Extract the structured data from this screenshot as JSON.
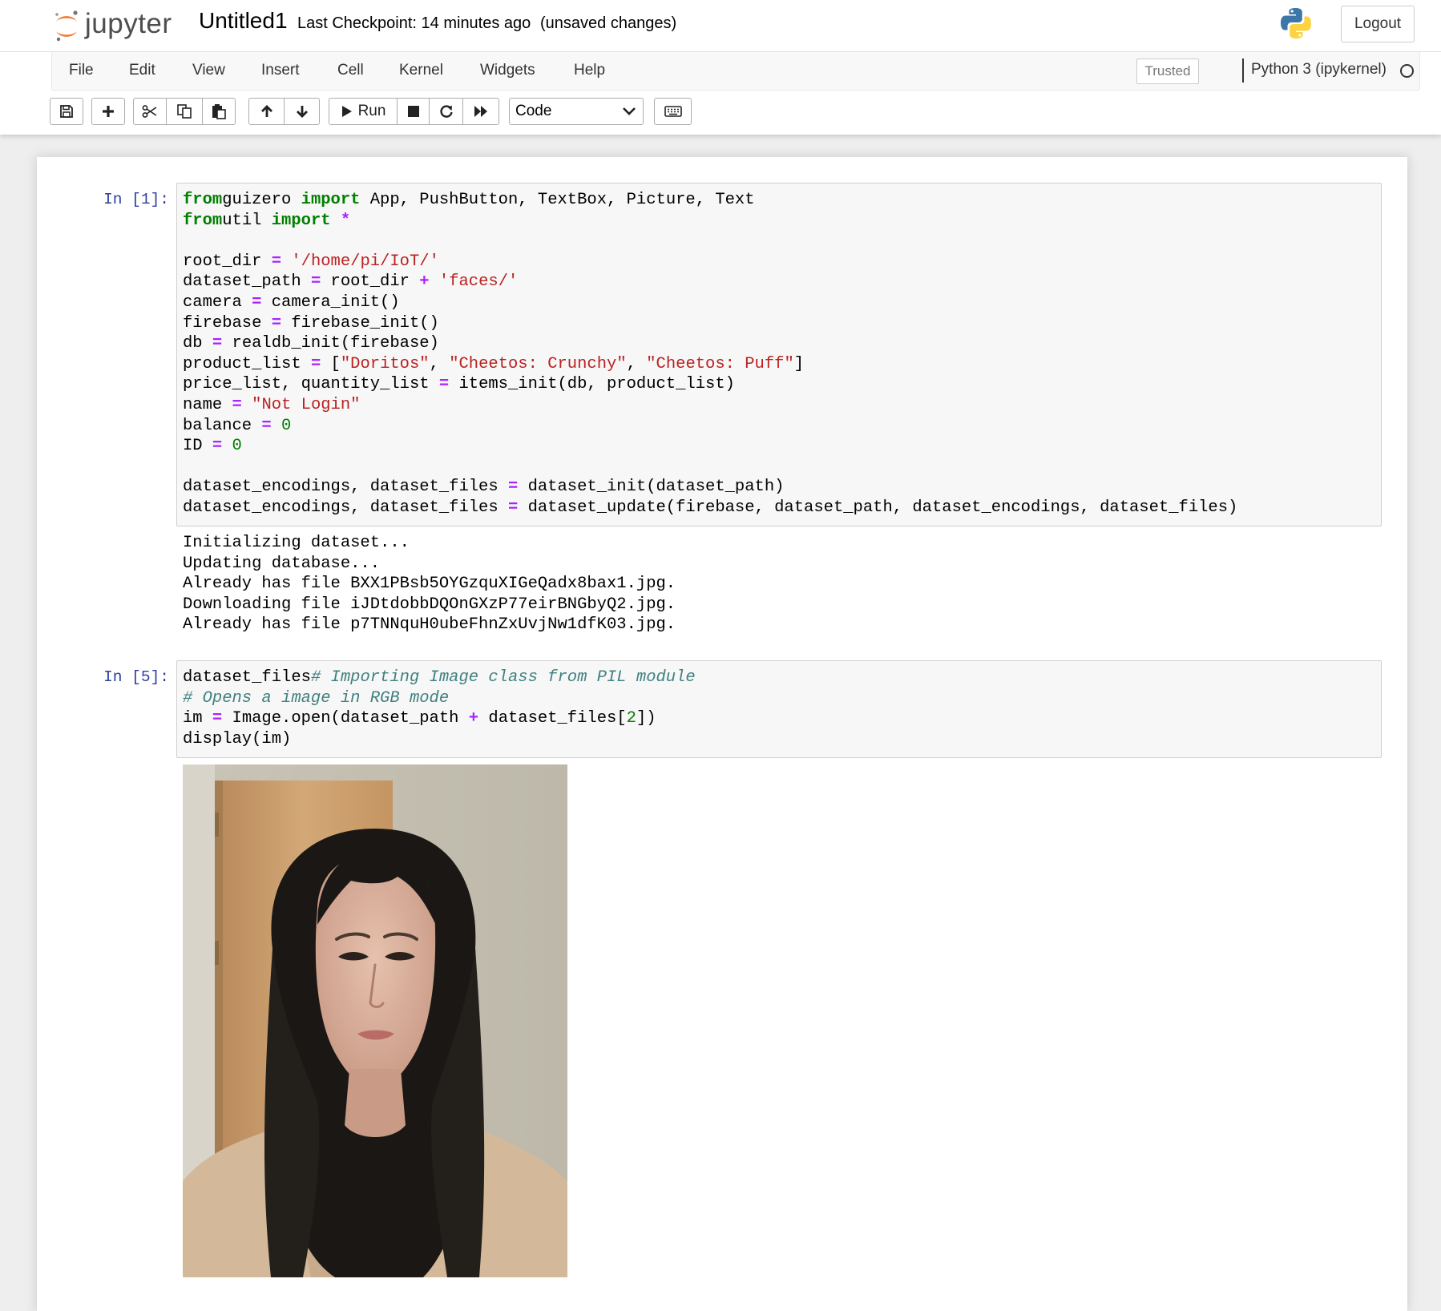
{
  "header": {
    "logo_text": "jupyter",
    "notebook_name": "Untitled1",
    "checkpoint": "Last Checkpoint: 14 minutes ago",
    "save_status": "(unsaved changes)",
    "logout_label": "Logout"
  },
  "menu": {
    "items": [
      "File",
      "Edit",
      "View",
      "Insert",
      "Cell",
      "Kernel",
      "Widgets",
      "Help"
    ],
    "trusted_label": "Trusted",
    "kernel_name": "Python 3 (ipykernel)"
  },
  "toolbar": {
    "run_label": "Run",
    "cell_type": "Code",
    "icons": [
      "save-icon",
      "plus-icon",
      "cut-icon",
      "copy-icon",
      "paste-icon",
      "arrow-up-icon",
      "arrow-down-icon",
      "play-icon",
      "stop-icon",
      "restart-icon",
      "fast-forward-icon",
      "keyboard-icon"
    ]
  },
  "cells": [
    {
      "prompt": "In [1]:",
      "code_lines": [
        [
          [
            "kw",
            "from"
          ],
          [
            "",
            "guizero "
          ],
          [
            "kw",
            "import"
          ],
          [
            "",
            " App, PushButton, TextBox, Picture, Text"
          ]
        ],
        [
          [
            "kw",
            "from"
          ],
          [
            "",
            "util "
          ],
          [
            "kw",
            "import"
          ],
          [
            "",
            " "
          ],
          [
            "op",
            "*"
          ]
        ],
        [],
        [
          [
            "",
            "root_dir "
          ],
          [
            "op",
            "="
          ],
          [
            "",
            " "
          ],
          [
            "st",
            "'/home/pi/IoT/'"
          ]
        ],
        [
          [
            "",
            "dataset_path "
          ],
          [
            "op",
            "="
          ],
          [
            "",
            " root_dir "
          ],
          [
            "op",
            "+"
          ],
          [
            "",
            " "
          ],
          [
            "st",
            "'faces/'"
          ]
        ],
        [
          [
            "",
            "camera "
          ],
          [
            "op",
            "="
          ],
          [
            "",
            " camera_init()"
          ]
        ],
        [
          [
            "",
            "firebase "
          ],
          [
            "op",
            "="
          ],
          [
            "",
            " firebase_init()"
          ]
        ],
        [
          [
            "",
            "db "
          ],
          [
            "op",
            "="
          ],
          [
            "",
            " realdb_init(firebase)"
          ]
        ],
        [
          [
            "",
            "product_list "
          ],
          [
            "op",
            "="
          ],
          [
            "",
            " ["
          ],
          [
            "st",
            "\"Doritos\""
          ],
          [
            "",
            ", "
          ],
          [
            "st",
            "\"Cheetos: Crunchy\""
          ],
          [
            "",
            ", "
          ],
          [
            "st",
            "\"Cheetos: Puff\""
          ],
          [
            "",
            "]"
          ]
        ],
        [
          [
            "",
            "price_list, quantity_list "
          ],
          [
            "op",
            "="
          ],
          [
            "",
            " items_init(db, product_list)"
          ]
        ],
        [
          [
            "",
            "name "
          ],
          [
            "op",
            "="
          ],
          [
            "",
            " "
          ],
          [
            "st",
            "\"Not Login\""
          ]
        ],
        [
          [
            "",
            "balance "
          ],
          [
            "op",
            "="
          ],
          [
            "",
            " "
          ],
          [
            "nm",
            "0"
          ]
        ],
        [
          [
            "",
            "ID "
          ],
          [
            "op",
            "="
          ],
          [
            "",
            " "
          ],
          [
            "nm",
            "0"
          ]
        ],
        [],
        [
          [
            "",
            "dataset_encodings, dataset_files "
          ],
          [
            "op",
            "="
          ],
          [
            "",
            " dataset_init(dataset_path)"
          ]
        ],
        [
          [
            "",
            "dataset_encodings, dataset_files "
          ],
          [
            "op",
            "="
          ],
          [
            "",
            " dataset_update(firebase, dataset_path, dataset_encodings, dataset_files)"
          ]
        ]
      ],
      "output": [
        "Initializing dataset...",
        "Updating database...",
        "Already has file BXX1PBsb5OYGzquXIGeQadx8bax1.jpg.",
        "Downloading file iJDtdobbDQOnGXzP77eirBNGbyQ2.jpg.",
        "Already has file p7TNNquH0ubeFhnZxUvjNw1dfK03.jpg."
      ]
    },
    {
      "prompt": "In [5]:",
      "code_lines": [
        [
          [
            "",
            "dataset_files"
          ],
          [
            "cm",
            "# Importing Image class from PIL module"
          ]
        ],
        [
          [
            "cm",
            "# Opens a image in RGB mode"
          ]
        ],
        [
          [
            "",
            "im "
          ],
          [
            "op",
            "="
          ],
          [
            "",
            " Image.open(dataset_path "
          ],
          [
            "op",
            "+"
          ],
          [
            "",
            " dataset_files["
          ],
          [
            "nm",
            "2"
          ],
          [
            "",
            "])"
          ]
        ],
        [
          [
            "",
            "display(im)"
          ]
        ]
      ],
      "output_image": "portrait-photo"
    }
  ]
}
